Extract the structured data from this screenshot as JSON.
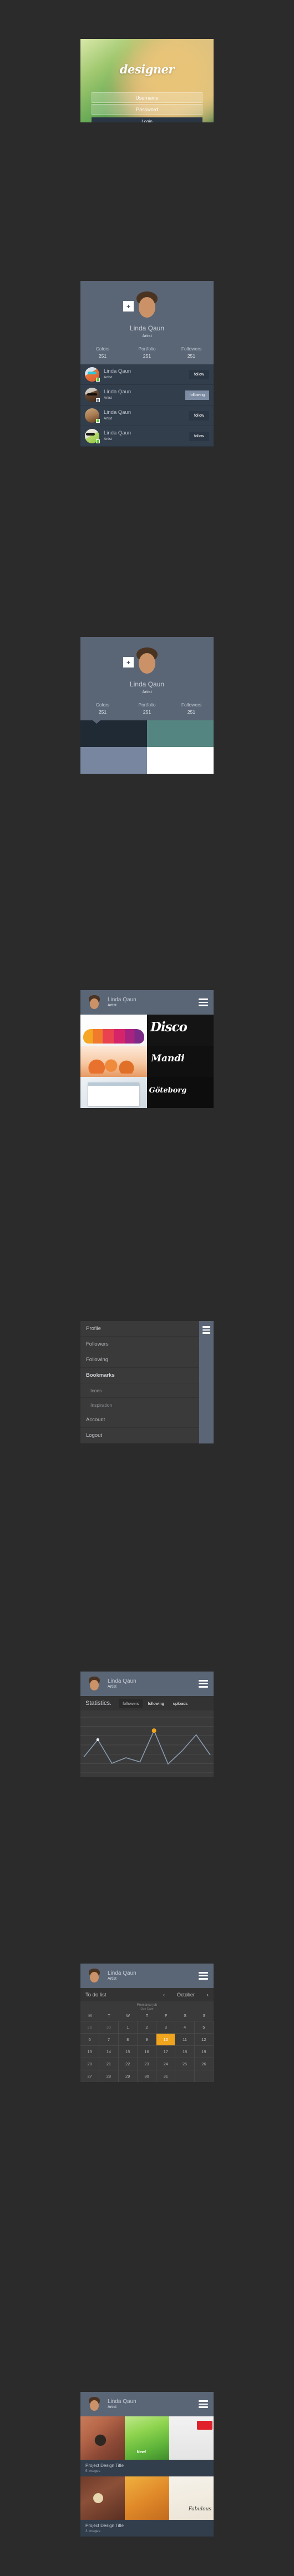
{
  "app": {
    "logo": "designer"
  },
  "login": {
    "username_placeholder": "Username",
    "password_placeholder": "Password",
    "login_label": "Login"
  },
  "user": {
    "name": "Linda Qaun",
    "role": "Artist"
  },
  "profile": {
    "name": "Linda Qaun",
    "role": "Artist",
    "add_icon": "+",
    "stats": [
      {
        "label": "Colors",
        "value": "251"
      },
      {
        "label": "Portfolio",
        "value": "251"
      },
      {
        "label": "Followers",
        "value": "251"
      }
    ]
  },
  "followers": {
    "items": [
      {
        "name": "Linda Qaun",
        "role": "Artist",
        "action": "follow",
        "following": false,
        "status": "online"
      },
      {
        "name": "Linda Qaun",
        "role": "Artist",
        "action": "following",
        "following": true,
        "status": "offline"
      },
      {
        "name": "Linda Qaun",
        "role": "Artist",
        "action": "follow",
        "following": false,
        "status": "online"
      },
      {
        "name": "Linda Qaun",
        "role": "Artist",
        "action": "follow",
        "following": false,
        "status": "online"
      }
    ]
  },
  "colors": {
    "swatches": [
      {
        "name": "dark-navy",
        "hex": "#1f2a35"
      },
      {
        "name": "teal",
        "hex": "#558580"
      },
      {
        "name": "blue-gray",
        "hex": "#78879f"
      },
      {
        "name": "white",
        "hex": "#ffffff"
      }
    ]
  },
  "portfolio": {
    "items": [
      {
        "title": "Colorful Waves"
      },
      {
        "title": "Disco"
      },
      {
        "title": "Orange Spheres"
      },
      {
        "title": "Mandi"
      },
      {
        "title": "Print Layout"
      },
      {
        "title": "Göteborg"
      }
    ]
  },
  "menu": {
    "items": [
      {
        "label": "Profile",
        "bold": false,
        "sub": false
      },
      {
        "label": "Followers",
        "bold": false,
        "sub": false
      },
      {
        "label": "Following",
        "bold": false,
        "sub": false
      },
      {
        "label": "Bookmarks",
        "bold": true,
        "sub": false
      },
      {
        "label": "Icons",
        "bold": false,
        "sub": true
      },
      {
        "label": "Inspiration",
        "bold": false,
        "sub": true
      },
      {
        "label": "Account",
        "bold": false,
        "sub": false
      },
      {
        "label": "Logout",
        "bold": false,
        "sub": false
      }
    ]
  },
  "statistics": {
    "title": "Statistics.",
    "tabs": [
      {
        "label": "followers",
        "active": true
      },
      {
        "label": "following",
        "active": false
      },
      {
        "label": "uploads",
        "active": false
      }
    ],
    "accent": "#f0a41e"
  },
  "chart_data": {
    "type": "line",
    "title": "Statistics.",
    "xlabel": "",
    "ylabel": "",
    "grid": true,
    "legend": false,
    "ylim": [
      0,
      8
    ],
    "x": [
      1,
      2,
      3,
      4,
      5,
      6,
      7,
      8,
      9,
      10
    ],
    "series": [
      {
        "name": "followers",
        "values": [
          2.1,
          4.6,
          1.2,
          2.0,
          1.4,
          5.9,
          1.1,
          3.0,
          5.3,
          2.4
        ],
        "color": "#8a9bb0",
        "highlight_index": 5,
        "highlight_color": "#f0a41e"
      }
    ]
  },
  "calendar": {
    "title": "To do list",
    "month": "October",
    "prev_icon": "‹",
    "next_icon": "›",
    "note_line1": "Freelance job",
    "note_line2": "Due Date",
    "dow": [
      "M",
      "T",
      "W",
      "T",
      "F",
      "S",
      "S"
    ],
    "weeks": [
      [
        {
          "d": "29",
          "dim": true
        },
        {
          "d": "30",
          "dim": true
        },
        {
          "d": "1",
          "dim": false
        },
        {
          "d": "2",
          "dim": false
        },
        {
          "d": "3",
          "dim": false
        },
        {
          "d": "4",
          "dim": false
        },
        {
          "d": "5",
          "dim": false
        }
      ],
      [
        {
          "d": "6",
          "dim": false
        },
        {
          "d": "7",
          "dim": false
        },
        {
          "d": "8",
          "dim": false
        },
        {
          "d": "9",
          "dim": false
        },
        {
          "d": "10",
          "dim": false,
          "hot": true
        },
        {
          "d": "11",
          "dim": false
        },
        {
          "d": "12",
          "dim": false
        }
      ],
      [
        {
          "d": "13",
          "dim": false
        },
        {
          "d": "14",
          "dim": false
        },
        {
          "d": "15",
          "dim": false
        },
        {
          "d": "16",
          "dim": false
        },
        {
          "d": "17",
          "dim": false
        },
        {
          "d": "18",
          "dim": false
        },
        {
          "d": "19",
          "dim": false
        }
      ],
      [
        {
          "d": "20",
          "dim": false
        },
        {
          "d": "21",
          "dim": false
        },
        {
          "d": "22",
          "dim": false
        },
        {
          "d": "23",
          "dim": false
        },
        {
          "d": "24",
          "dim": false
        },
        {
          "d": "25",
          "dim": false
        },
        {
          "d": "26",
          "dim": false
        }
      ],
      [
        {
          "d": "27",
          "dim": false
        },
        {
          "d": "28",
          "dim": false
        },
        {
          "d": "29",
          "dim": false
        },
        {
          "d": "30",
          "dim": false
        },
        {
          "d": "31",
          "dim": false
        },
        {
          "d": "",
          "dim": true
        },
        {
          "d": "",
          "dim": true
        }
      ]
    ],
    "highlight_color": "#f0a41e"
  },
  "projects": [
    {
      "title": "Project Design Title",
      "subtitle": "5 Images"
    },
    {
      "title": "Project Design Title",
      "subtitle": "3 Images"
    }
  ]
}
